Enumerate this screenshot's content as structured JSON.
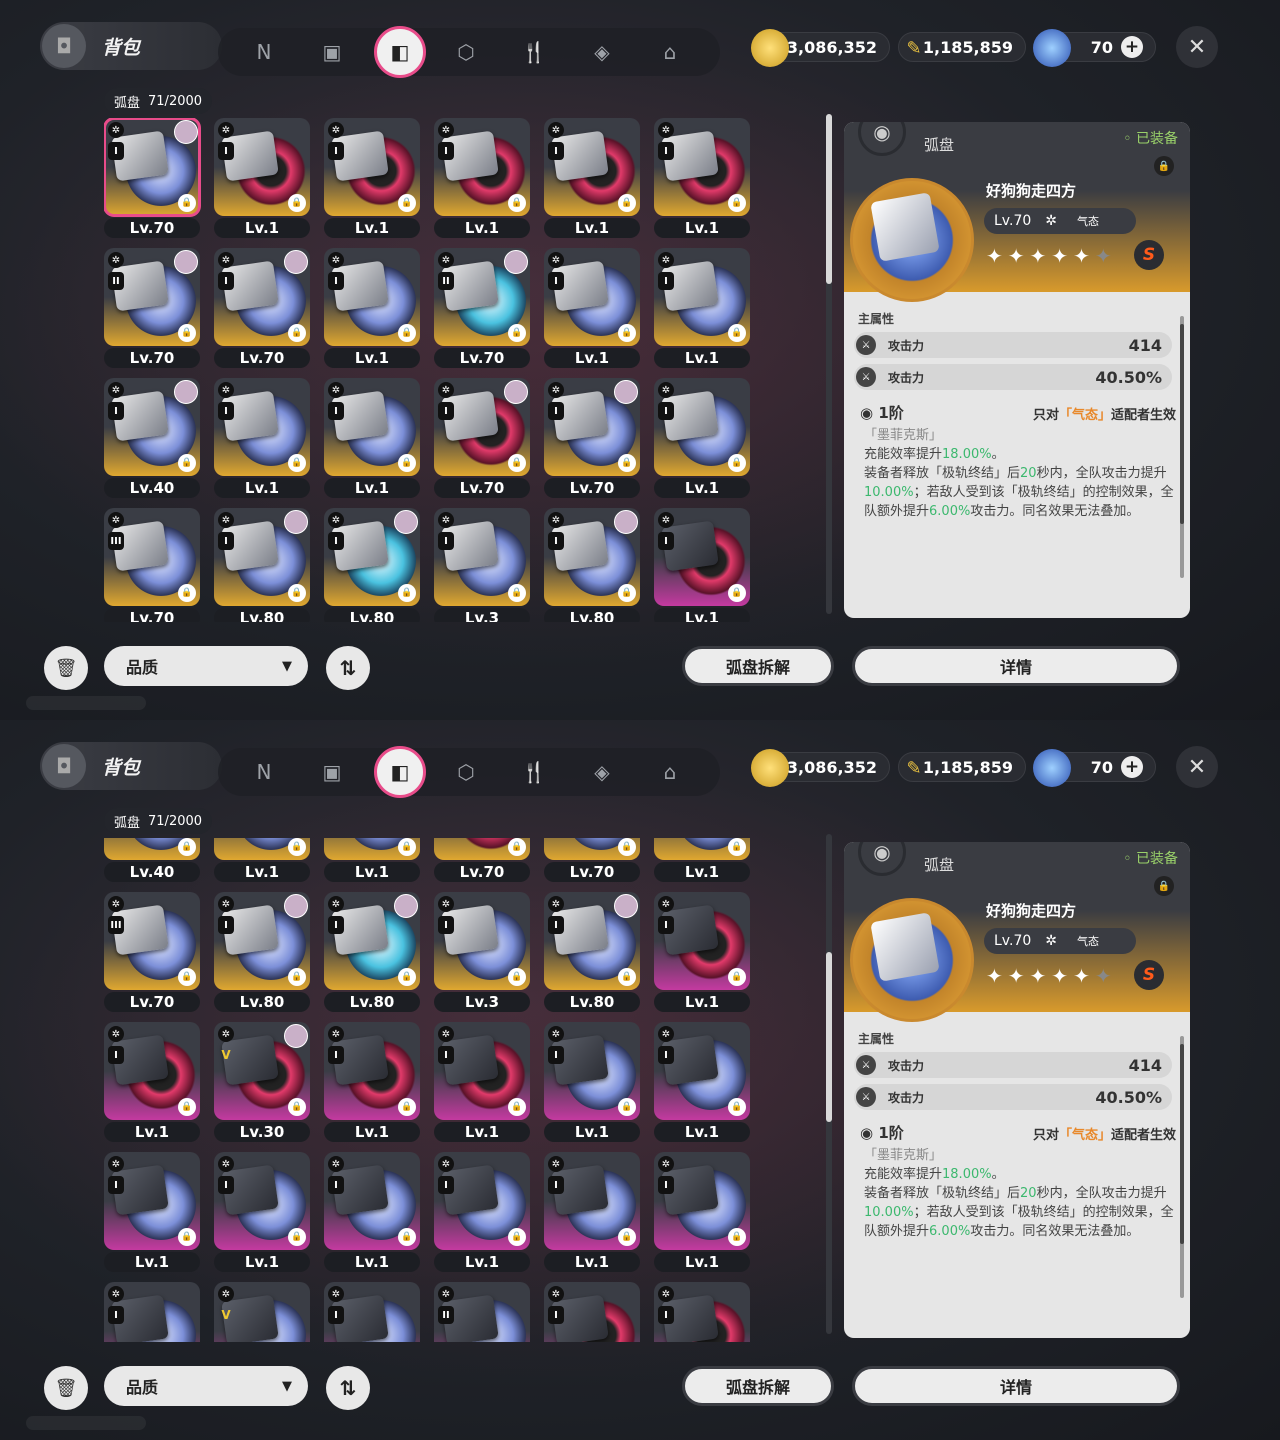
{
  "header": {
    "title": "背包",
    "tabs": [
      "N",
      "▣",
      "◧",
      "⬡",
      "🍴",
      "◈",
      "⌂"
    ],
    "active_tab": 2,
    "currencies": [
      {
        "icon": "gold-coin-icon",
        "value": "3,086,352"
      },
      {
        "icon": "ticket-icon",
        "value": "1,185,859"
      },
      {
        "icon": "battery-icon",
        "value": "70"
      }
    ]
  },
  "count": {
    "label": "弧盘",
    "value": "71/2000"
  },
  "items_top": [
    [
      {
        "lv": "Lv.70",
        "rank": "I",
        "q": "A",
        "sel": true,
        "av": true
      },
      {
        "lv": "Lv.1",
        "rank": "I",
        "q": "A",
        "disc": "red"
      },
      {
        "lv": "Lv.1",
        "rank": "I",
        "q": "A",
        "disc": "red"
      },
      {
        "lv": "Lv.1",
        "rank": "I",
        "q": "A",
        "disc": "red"
      },
      {
        "lv": "Lv.1",
        "rank": "I",
        "q": "A",
        "disc": "red"
      },
      {
        "lv": "Lv.1",
        "rank": "I",
        "q": "A",
        "disc": "red"
      }
    ],
    [
      {
        "lv": "Lv.70",
        "rank": "II",
        "q": "A",
        "av": true
      },
      {
        "lv": "Lv.70",
        "rank": "I",
        "q": "A",
        "av": true
      },
      {
        "lv": "Lv.1",
        "rank": "I",
        "q": "A"
      },
      {
        "lv": "Lv.70",
        "rank": "II",
        "q": "A",
        "av": true,
        "disc": "cyan"
      },
      {
        "lv": "Lv.1",
        "rank": "I",
        "q": "A"
      },
      {
        "lv": "Lv.1",
        "rank": "I",
        "q": "A"
      }
    ],
    [
      {
        "lv": "Lv.40",
        "rank": "I",
        "q": "A",
        "av": true
      },
      {
        "lv": "Lv.1",
        "rank": "I",
        "q": "A"
      },
      {
        "lv": "Lv.1",
        "rank": "I",
        "q": "A"
      },
      {
        "lv": "Lv.70",
        "rank": "I",
        "q": "A",
        "av": true,
        "disc": "red"
      },
      {
        "lv": "Lv.70",
        "rank": "I",
        "q": "A",
        "av": true
      },
      {
        "lv": "Lv.1",
        "rank": "I",
        "q": "A"
      }
    ],
    [
      {
        "lv": "Lv.70",
        "rank": "III",
        "q": "A"
      },
      {
        "lv": "Lv.80",
        "rank": "I",
        "q": "A",
        "av": true
      },
      {
        "lv": "Lv.80",
        "rank": "I",
        "q": "A",
        "av": true,
        "disc": "cyan"
      },
      {
        "lv": "Lv.3",
        "rank": "I",
        "q": "A"
      },
      {
        "lv": "Lv.80",
        "rank": "I",
        "q": "A",
        "av": true
      },
      {
        "lv": "Lv.1",
        "rank": "I",
        "q": "S",
        "disc": "red"
      }
    ]
  ],
  "items_bottom": [
    [
      {
        "lv": "Lv.40",
        "rank": "I",
        "q": "A"
      },
      {
        "lv": "Lv.1",
        "rank": "I",
        "q": "A"
      },
      {
        "lv": "Lv.1",
        "rank": "I",
        "q": "A"
      },
      {
        "lv": "Lv.70",
        "rank": "I",
        "q": "A",
        "disc": "red"
      },
      {
        "lv": "Lv.70",
        "rank": "I",
        "q": "A"
      },
      {
        "lv": "Lv.1",
        "rank": "I",
        "q": "A"
      }
    ],
    [
      {
        "lv": "Lv.70",
        "rank": "III",
        "q": "A"
      },
      {
        "lv": "Lv.80",
        "rank": "I",
        "q": "A",
        "av": true
      },
      {
        "lv": "Lv.80",
        "rank": "I",
        "q": "A",
        "av": true,
        "disc": "cyan"
      },
      {
        "lv": "Lv.3",
        "rank": "I",
        "q": "A"
      },
      {
        "lv": "Lv.80",
        "rank": "I",
        "q": "A",
        "av": true
      },
      {
        "lv": "Lv.1",
        "rank": "I",
        "q": "S",
        "disc": "red"
      }
    ],
    [
      {
        "lv": "Lv.1",
        "rank": "I",
        "q": "S",
        "disc": "red"
      },
      {
        "lv": "Lv.30",
        "rank": "V",
        "q": "S",
        "av": true,
        "disc": "red",
        "gold": true
      },
      {
        "lv": "Lv.1",
        "rank": "I",
        "q": "S",
        "disc": "red"
      },
      {
        "lv": "Lv.1",
        "rank": "I",
        "q": "S",
        "disc": "red"
      },
      {
        "lv": "Lv.1",
        "rank": "I",
        "q": "S"
      },
      {
        "lv": "Lv.1",
        "rank": "I",
        "q": "S"
      }
    ],
    [
      {
        "lv": "Lv.1",
        "rank": "I",
        "q": "S"
      },
      {
        "lv": "Lv.1",
        "rank": "I",
        "q": "S"
      },
      {
        "lv": "Lv.1",
        "rank": "I",
        "q": "S"
      },
      {
        "lv": "Lv.1",
        "rank": "I",
        "q": "S"
      },
      {
        "lv": "Lv.1",
        "rank": "I",
        "q": "S"
      },
      {
        "lv": "Lv.1",
        "rank": "I",
        "q": "S"
      }
    ],
    [
      {
        "lv": "",
        "rank": "I",
        "q": "S"
      },
      {
        "lv": "",
        "rank": "V",
        "q": "S",
        "gold": true
      },
      {
        "lv": "",
        "rank": "I",
        "q": "S"
      },
      {
        "lv": "",
        "rank": "II",
        "q": "S"
      },
      {
        "lv": "",
        "rank": "I",
        "q": "S",
        "disc": "red"
      },
      {
        "lv": "",
        "rank": "I",
        "q": "S",
        "disc": "red"
      }
    ]
  ],
  "detail": {
    "category": "弧盘",
    "equipped": "已装备",
    "name": "好狗狗走四方",
    "level": "Lv.70",
    "type": "气态",
    "rank": "S",
    "stars_lit": 5,
    "main_label": "主属性",
    "stats": [
      {
        "name": "攻击力",
        "value": "414"
      },
      {
        "name": "攻击力",
        "value": "40.50%"
      }
    ],
    "tier": "1阶",
    "tier_note_pre": "只对",
    "tier_note_type": "「气态」",
    "tier_note_post": "适配者生效",
    "desc_head": "「墨菲克斯」",
    "desc_1a": "充能效率提升",
    "desc_1b": "18.00%",
    "desc_1c": "。",
    "desc_2a": "装备者释放「极轨终结」后",
    "desc_2b": "20",
    "desc_2c": "秒内，全队攻击力提升",
    "desc_2d": "10.00%",
    "desc_2e": "；若敌人受到该「极轨终结」的控制效果，全队额外提升",
    "desc_2f": "6.00%",
    "desc_2g": "攻击力。同名效果无法叠加。"
  },
  "footer": {
    "sort_label": "品质",
    "dismantle": "弧盘拆解",
    "details": "详情"
  },
  "colors": {
    "accent": "#e84c8a",
    "gold": "#e0a830",
    "purple": "#c43aa0",
    "green": "#3cb86e",
    "orange": "#e8882a"
  }
}
